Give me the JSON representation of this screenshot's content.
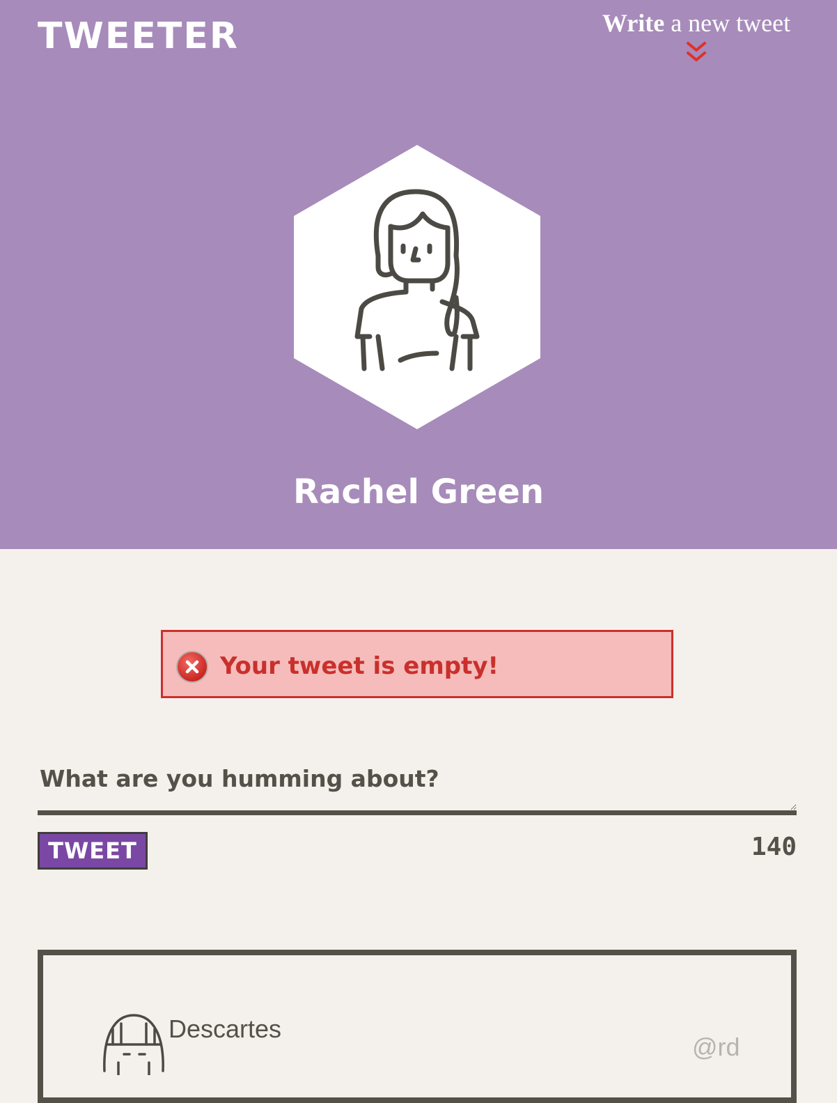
{
  "header": {
    "brand": "TWEETER",
    "compose_toggle": {
      "bold_word": "Write",
      "rest": "a new tweet"
    },
    "background_color": "#a78bba"
  },
  "profile": {
    "name": "Rachel Green",
    "avatar_icon": "woman-avatar-icon"
  },
  "error": {
    "message": "Your tweet is empty!",
    "icon": "error-x-icon",
    "color": "#c9302c",
    "background": "#f5bcbb"
  },
  "composer": {
    "placeholder": "What are you humming about?",
    "value": "",
    "button_label": "TWEET",
    "button_color": "#7a48a4",
    "char_counter": "140"
  },
  "tweets": [
    {
      "name": "Descartes",
      "handle": "@rd",
      "avatar_icon": "user-avatar-icon"
    }
  ]
}
